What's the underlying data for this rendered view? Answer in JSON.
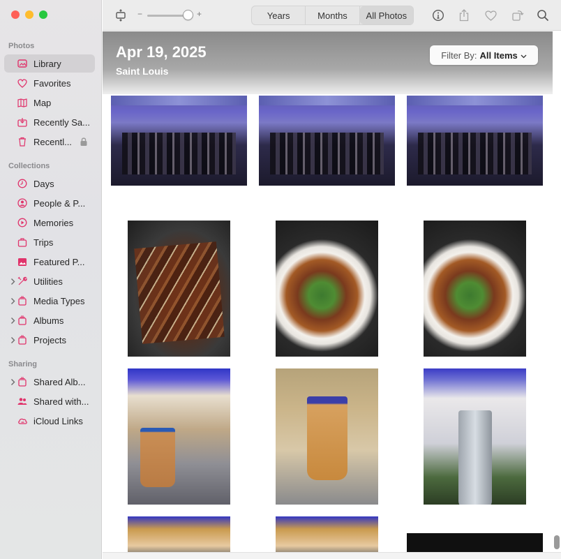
{
  "window": {
    "traffic_lights": [
      {
        "name": "close",
        "color": "#fe5f57"
      },
      {
        "name": "minimize",
        "color": "#febc2e"
      },
      {
        "name": "zoom",
        "color": "#28c840"
      }
    ]
  },
  "sidebar": {
    "sections": [
      {
        "title": "Photos"
      },
      {
        "title": "Collections"
      },
      {
        "title": "Sharing"
      }
    ],
    "items": [
      {
        "label": "Library",
        "icon": "photo-library-icon",
        "selected": true
      },
      {
        "label": "Favorites",
        "icon": "heart-icon"
      },
      {
        "label": "Map",
        "icon": "map-icon"
      },
      {
        "label": "Recently Sa...",
        "icon": "recently-saved-icon"
      },
      {
        "label": "Recentl...",
        "icon": "trash-icon",
        "locked": true
      },
      {
        "label": "Days",
        "icon": "clock-icon"
      },
      {
        "label": "People & P...",
        "icon": "person-icon"
      },
      {
        "label": "Memories",
        "icon": "memories-icon"
      },
      {
        "label": "Trips",
        "icon": "suitcase-icon"
      },
      {
        "label": "Featured P...",
        "icon": "featured-photo-icon"
      },
      {
        "label": "Utilities",
        "icon": "tools-icon",
        "expandable": true
      },
      {
        "label": "Media Types",
        "icon": "stack-icon",
        "expandable": true
      },
      {
        "label": "Albums",
        "icon": "album-stack-icon",
        "expandable": true
      },
      {
        "label": "Projects",
        "icon": "project-stack-icon",
        "expandable": true
      },
      {
        "label": "Shared Alb...",
        "icon": "shared-album-icon",
        "expandable": true
      },
      {
        "label": "Shared with...",
        "icon": "shared-with-you-icon"
      },
      {
        "label": "iCloud Links",
        "icon": "icloud-link-icon"
      }
    ]
  },
  "toolbar": {
    "zoom_minus": "−",
    "zoom_plus": "+",
    "zoom_level": 0.85,
    "view_segments": [
      "Years",
      "Months",
      "All Photos"
    ],
    "active_segment": "All Photos",
    "icons": [
      "aspect-toggle-icon",
      "info-icon",
      "share-icon",
      "heart-icon",
      "rotate-icon",
      "search-icon"
    ]
  },
  "main": {
    "date_title": "Apr 19, 2025",
    "location": "Saint Louis",
    "filter_label": "Filter By:",
    "filter_value": "All Items"
  }
}
